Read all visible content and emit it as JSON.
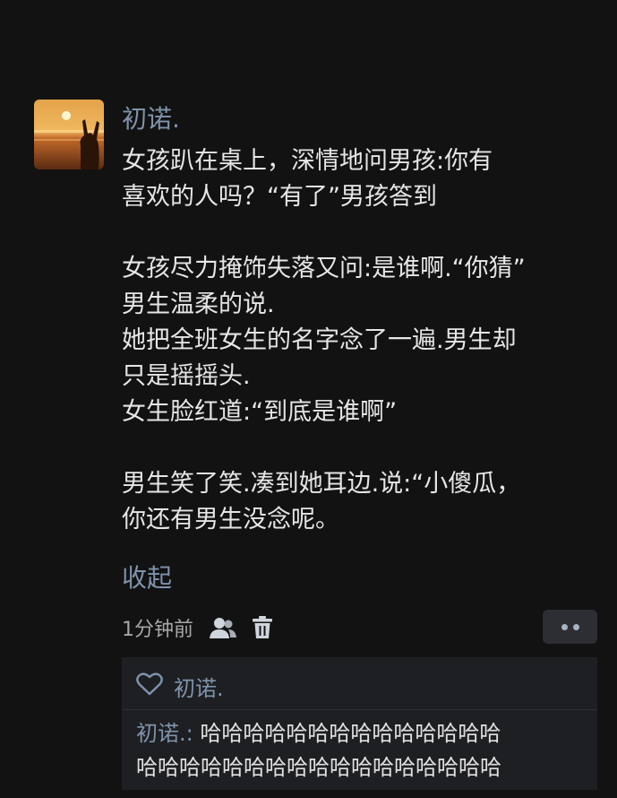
{
  "post": {
    "username": "初诺.",
    "body_lines": [
      "女孩趴在桌上，深情地问男孩:你有",
      "喜欢的人吗？“有了”男孩答到",
      "",
      "女孩尽力掩饰失落又问:是谁啊.“你猜”",
      "男生温柔的说.",
      "她把全班女生的名字念了一遍.男生却",
      "只是摇摇头.",
      "女生脸红道:“到底是谁啊”",
      "",
      "男生笑了笑.凑到她耳边.说:“小傻瓜，",
      "你还有男生没念呢。"
    ],
    "collapse_label": "收起",
    "timestamp": "1分钟前"
  },
  "icons": {
    "visibility": "person-icon",
    "delete": "trash-icon",
    "more": "more-dots-icon",
    "like": "heart-icon"
  },
  "likes": {
    "liker": "初诺."
  },
  "comment": {
    "author": "初诺.:",
    "text_line1": "哈哈哈哈哈哈哈哈哈哈哈哈哈哈",
    "text_line2": "哈哈哈哈哈哈哈哈哈哈哈哈哈哈哈哈哈"
  },
  "colors": {
    "background": "#121212",
    "link": "#7f93ab",
    "text": "#e6e6e6",
    "panel": "#1e1f22"
  }
}
